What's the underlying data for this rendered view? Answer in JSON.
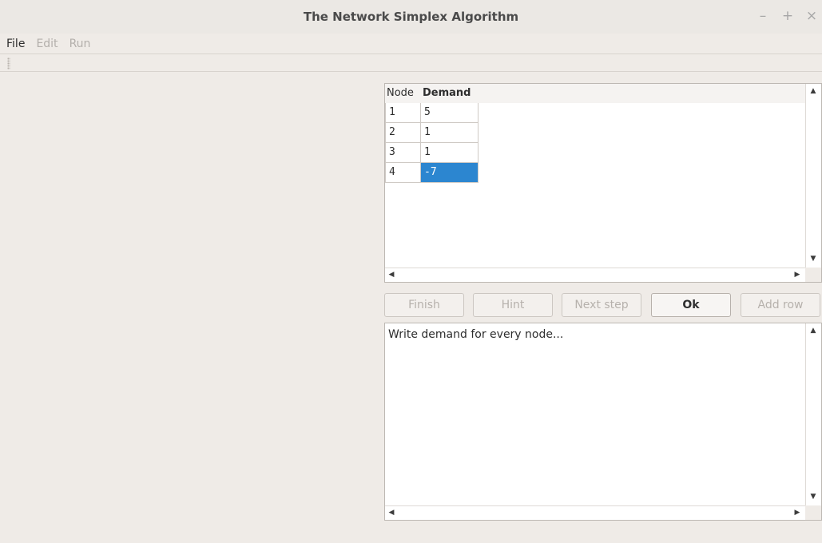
{
  "window": {
    "title": "The Network Simplex Algorithm",
    "minimize": "–",
    "maximize": "+",
    "close": "×"
  },
  "menu": {
    "items": [
      {
        "label": "File",
        "enabled": true
      },
      {
        "label": "Edit",
        "enabled": false
      },
      {
        "label": "Run",
        "enabled": false
      }
    ]
  },
  "table": {
    "columns": [
      "Node",
      "Demand"
    ],
    "rows": [
      {
        "node": "1",
        "demand": "5"
      },
      {
        "node": "2",
        "demand": "1"
      },
      {
        "node": "3",
        "demand": "1"
      },
      {
        "node": "4",
        "demand": "-7"
      }
    ],
    "selected_row": 4
  },
  "buttons": {
    "finish": "Finish",
    "hint": "Hint",
    "next_step": "Next step",
    "ok": "Ok",
    "add_row": "Add row"
  },
  "output": {
    "text": "Write demand for every node..."
  },
  "icons": {
    "scroll_up": "triangle-up",
    "scroll_down": "triangle-down",
    "scroll_left": "triangle-left",
    "scroll_right": "triangle-right"
  },
  "colors": {
    "selection": "#2c86d0",
    "window_bg": "#efebe7"
  }
}
